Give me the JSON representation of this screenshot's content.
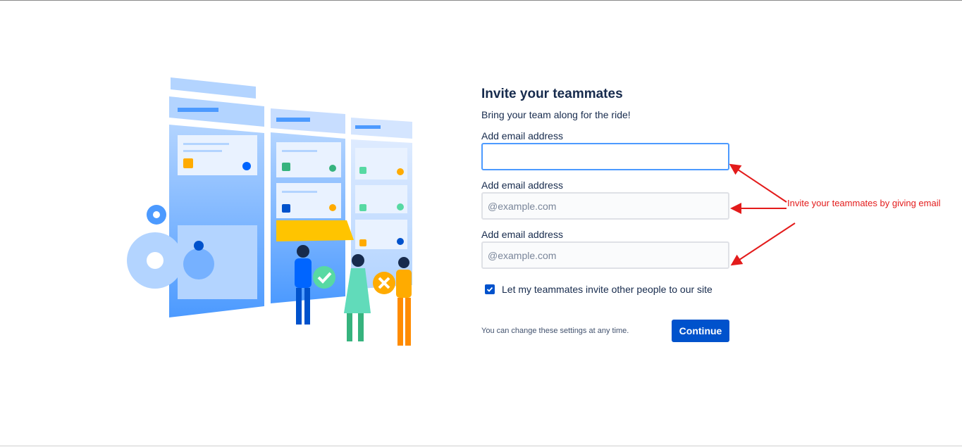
{
  "form": {
    "title": "Invite your teammates",
    "subtitle": "Bring your team along for the ride!",
    "fields": [
      {
        "label": "Add email address",
        "value": "",
        "placeholder": ""
      },
      {
        "label": "Add email address",
        "value": "",
        "placeholder": "@example.com"
      },
      {
        "label": "Add email address",
        "value": "",
        "placeholder": "@example.com"
      }
    ],
    "checkbox_label": "Let my teammates invite other people to our site",
    "checkbox_checked": true,
    "note": "You can change these settings at any time.",
    "continue_label": "Continue"
  },
  "annotation": {
    "text": "Invite your teammates by giving email",
    "color": "#e31b1b"
  },
  "colors": {
    "primary": "#0052CC",
    "focus": "#4C9AFF"
  }
}
